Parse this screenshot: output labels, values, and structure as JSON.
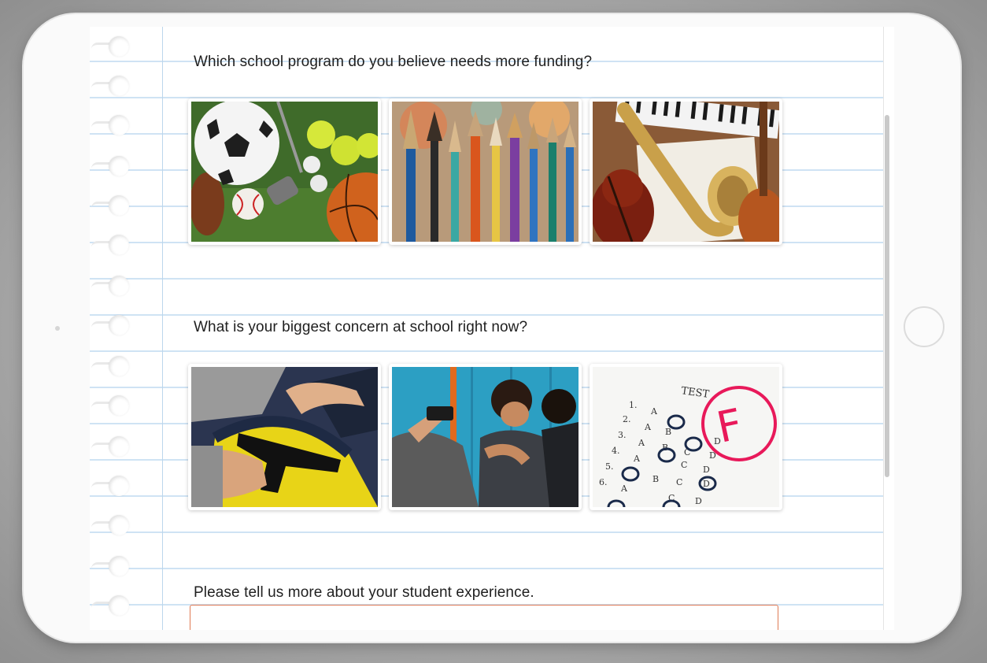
{
  "survey": {
    "q1": {
      "text": "Which school program do you believe needs more funding?",
      "options": [
        "sports-equipment-image",
        "paintbrushes-image",
        "musical-instruments-image"
      ]
    },
    "q2": {
      "text": "What is your biggest concern at school right now?",
      "options": [
        "gun-in-backpack-image",
        "bullying-image",
        "failing-test-image"
      ],
      "test_label": "TEST",
      "grade": "F"
    },
    "q3": {
      "text": "Please tell us more about your student experience.",
      "input_value": ""
    }
  },
  "colors": {
    "ruled_line": "#cfe3f4",
    "textarea_border": "#e07b54",
    "grade_mark": "#e8195a"
  }
}
